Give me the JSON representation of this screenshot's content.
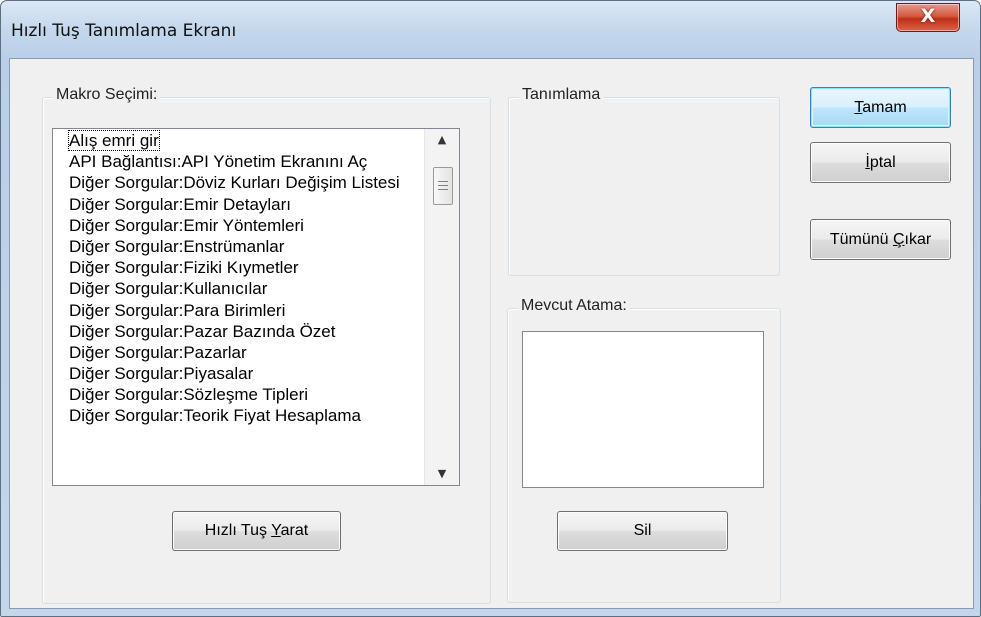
{
  "window": {
    "title": "Hızlı Tuş Tanımlama Ekranı",
    "close_glyph": "X"
  },
  "macro_group": {
    "legend": "Makro Seçimi:",
    "items": [
      "Alış emri gir",
      "API Bağlantısı:API Yönetim Ekranını Aç",
      "Diğer Sorgular:Döviz Kurları Değişim Listesi",
      "Diğer Sorgular:Emir Detayları",
      "Diğer Sorgular:Emir Yöntemleri",
      "Diğer Sorgular:Enstrümanlar",
      "Diğer Sorgular:Fiziki Kıymetler",
      "Diğer Sorgular:Kullanıcılar",
      "Diğer Sorgular:Para Birimleri",
      "Diğer Sorgular:Pazar Bazında Özet",
      "Diğer Sorgular:Pazarlar",
      "Diğer Sorgular:Piyasalar",
      "Diğer Sorgular:Sözleşme Tipleri",
      "Diğer Sorgular:Teorik Fiyat Hesaplama"
    ],
    "create_button": {
      "pre": "Hızlı Tuş ",
      "mnemonic": "Y",
      "post": "arat"
    }
  },
  "definition_group": {
    "legend": "Tanımlama"
  },
  "current_group": {
    "legend": "Mevcut Atama:",
    "delete_button": "Sil"
  },
  "buttons": {
    "ok": {
      "pre": "",
      "mnemonic": "T",
      "post": "amam"
    },
    "cancel": {
      "pre": "",
      "mnemonic": "İ",
      "post": "ptal"
    },
    "remove_all": {
      "pre": "Tümünü ",
      "mnemonic": "Ç",
      "post": "ıkar"
    }
  },
  "scrollbar": {
    "up_glyph": "▲",
    "down_glyph": "▼"
  },
  "colors": {
    "dialog_bg": "#f0f0f0",
    "title_bg": "#c3d7ec",
    "close_red": "#c9391d",
    "default_button_border": "#3c7fb1"
  }
}
